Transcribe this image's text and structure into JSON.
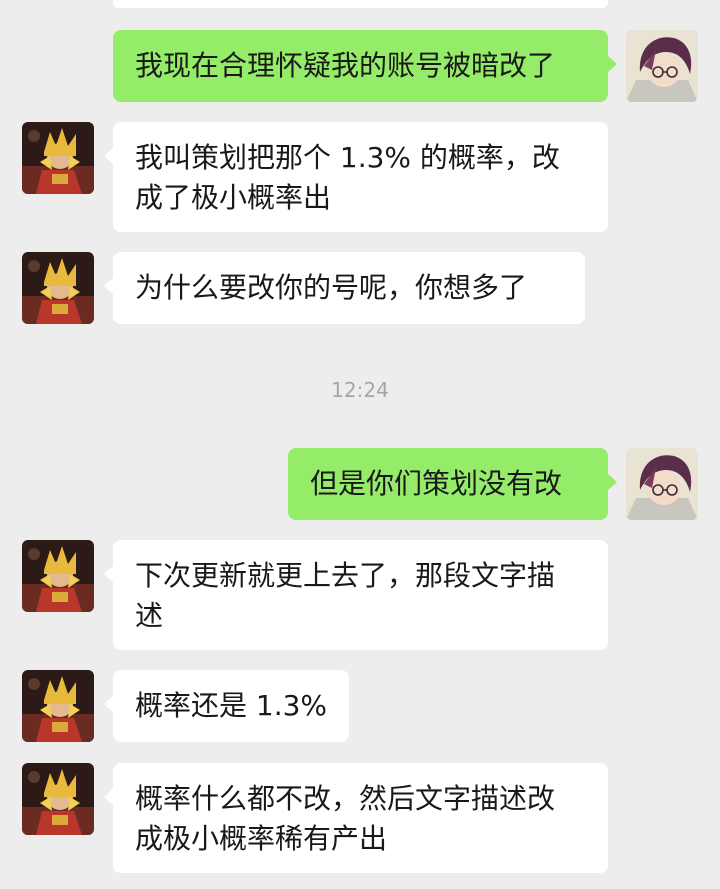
{
  "messages": [
    {
      "from": "me",
      "lines": [
        "我现在合理怀疑我的账号被暗改了"
      ]
    },
    {
      "from": "other",
      "lines": [
        "我叫策划把那个 1.3% 的概率，改",
        "成了极小概率出"
      ]
    },
    {
      "from": "other",
      "lines": [
        "为什么要改你的号呢，你想多了"
      ]
    },
    {
      "from": "me",
      "lines": [
        "但是你们策划没有改"
      ]
    },
    {
      "from": "other",
      "lines": [
        "下次更新就更上去了，那段文字描",
        "述"
      ]
    },
    {
      "from": "other",
      "lines": [
        "概率还是 1.3%"
      ]
    },
    {
      "from": "other",
      "lines": [
        "概率什么都不改，然后文字描述改",
        "成极小概率稀有产出"
      ]
    }
  ],
  "timestamp": "12:24",
  "colors": {
    "background": "#ededed",
    "my_bubble": "#95ec69",
    "other_bubble": "#ffffff",
    "text": "#191919",
    "timestamp": "#a6a6a6"
  },
  "icons": {
    "my_avatar": "anime-portrait-avatar-icon",
    "other_avatar": "golden-armored-hero-avatar-icon"
  }
}
